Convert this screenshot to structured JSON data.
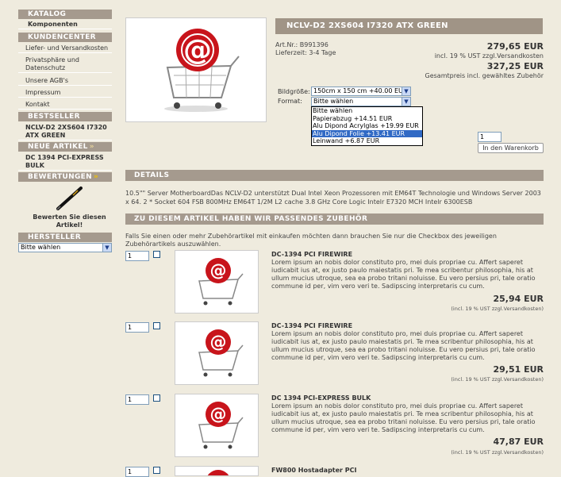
{
  "sidebar": {
    "katalog_title": "KATALOG",
    "katalog_items": [
      "Komponenten"
    ],
    "kundencenter_title": "KUNDENCENTER",
    "kundencenter_items": [
      "Liefer- und Versandkosten",
      "Privatsphäre und Datenschutz",
      "Unsere AGB's",
      "Impressum",
      "Kontakt"
    ],
    "bestseller_title": "BESTSELLER",
    "bestseller_item": "NCLV-D2 2XS604 I7320 ATX GREEN",
    "neue_title": "NEUE ARTIKEL",
    "neue_item": "DC 1394 PCI-EXPRESS BULK",
    "bewertungen_title": "BEWERTUNGEN",
    "bewertungen_text": "Bewerten Sie diesen Artikel!",
    "hersteller_title": "HERSTELLER",
    "hersteller_select": "Bitte wählen"
  },
  "product": {
    "title": "NCLV-D2 2XS604 I7320 ATX GREEN",
    "art_nr": "Art.Nr.: B991396",
    "lieferzeit": "Lieferzeit: 3-4 Tage",
    "price": "279,65 EUR",
    "price_note": "incl. 19 % UST zzgl.Versandkosten",
    "total": "327,25 EUR",
    "total_note": "Gesamtpreis incl. gewähltes Zubehör",
    "bildgroesse_label": "Bildgröße:",
    "bildgroesse_value": "150cm x 150 cm +40.00 EUR",
    "format_label": "Format:",
    "format_value": "Bitte wählen",
    "format_options": [
      "Bitte wählen",
      "Papierabzug +14.51 EUR",
      "Alu Dipond Acrylglas +19.99 EUR",
      "Alu Dipond Folie +13.41 EUR",
      "Leinwand +6.87 EUR"
    ],
    "format_highlight_index": 3,
    "qty": "1",
    "cart_button": "In den Warenkorb"
  },
  "details": {
    "title": "DETAILS",
    "text": "10.5\"\" Server MotherboardDas NCLV-D2 unterstützt Dual Intel Xeon Prozessoren mit EM64T Technologie und Windows Server 2003 x 64. 2 * Socket 604 FSB 800MHz EM64T 1/2M L2 cache 3.8 GHz Core Logic Intelr E7320 MCH Intelr 6300ESB"
  },
  "zubehoer": {
    "title": "ZU DIESEM ARTIKEL HABEN WIR PASSENDES ZUBEHÖR",
    "intro": "Falls Sie einen oder mehr Zubehörartikel mit einkaufen möchten dann brauchen Sie nur die Checkbox des jeweiligen Zubehörartikels auszuwählen.",
    "items": [
      {
        "qty": "1",
        "name": "DC-1394 PCI FIREWIRE",
        "desc": "Lorem ipsum an nobis dolor constituto pro, mei duis propriae cu. Affert saperet iudicabit ius at, ex justo paulo maiestatis pri. Te mea scribentur philosophia, his at ullum mucius utroque, sea ea probo tritani noluisse. Eu vero persius pri, tale oratio commune id per, vim vero veri te. Sadipscing interpretaris cu cum.",
        "price": "25,94 EUR",
        "tax": "(incl. 19 % UST zzgl.Versandkosten)"
      },
      {
        "qty": "1",
        "name": "DC-1394 PCI FIREWIRE",
        "desc": "Lorem ipsum an nobis dolor constituto pro, mei duis propriae cu. Affert saperet iudicabit ius at, ex justo paulo maiestatis pri. Te mea scribentur philosophia, his at ullum mucius utroque, sea ea probo tritani noluisse. Eu vero persius pri, tale oratio commune id per, vim vero veri te. Sadipscing interpretaris cu cum.",
        "price": "29,51 EUR",
        "tax": "(incl. 19 % UST zzgl.Versandkosten)"
      },
      {
        "qty": "1",
        "name": "DC 1394 PCI-EXPRESS BULK",
        "desc": "Lorem ipsum an nobis dolor constituto pro, mei duis propriae cu. Affert saperet iudicabit ius at, ex justo paulo maiestatis pri. Te mea scribentur philosophia, his at ullum mucius utroque, sea ea probo tritani noluisse. Eu vero persius pri, tale oratio commune id per, vim vero veri te. Sadipscing interpretaris cu cum.",
        "price": "47,87 EUR",
        "tax": "(incl. 19 % UST zzgl.Versandkosten)"
      },
      {
        "qty": "1",
        "name": "FW800 Hostadapter PCI",
        "desc": "",
        "price": "",
        "tax": ""
      }
    ]
  }
}
